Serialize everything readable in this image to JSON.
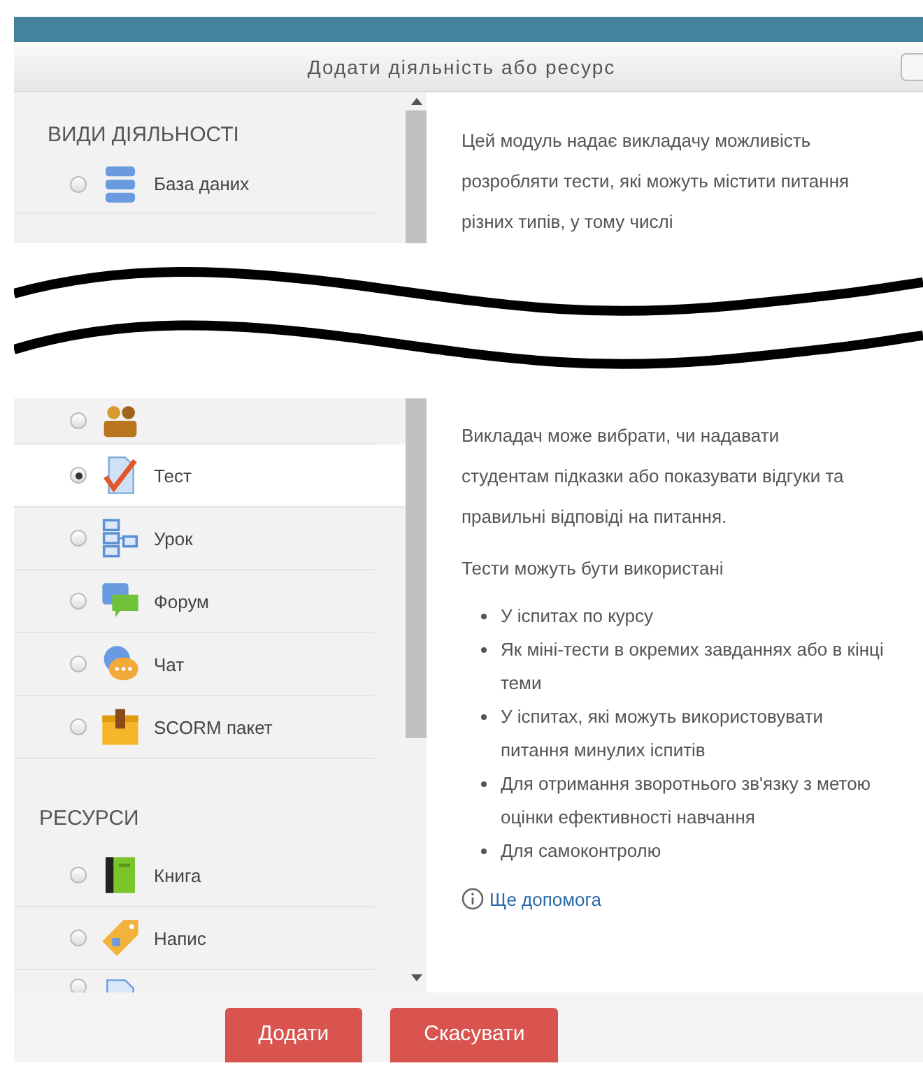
{
  "window": {
    "title": "Додати діяльність або ресурс"
  },
  "top": {
    "section": "ВИДИ ДІЯЛЬНОСТІ",
    "items": [
      {
        "label": "База даних",
        "kind": "database",
        "selected": false
      }
    ],
    "description": "Цей модуль надає викладачу можливість розробляти тести, які можуть містити питання різних типів, у тому числі"
  },
  "bottom": {
    "groups": [
      {
        "items": [
          {
            "kind": "workshop",
            "selected": false
          },
          {
            "label": "Тест",
            "kind": "quiz",
            "selected": true
          },
          {
            "label": "Урок",
            "kind": "lesson",
            "selected": false
          },
          {
            "label": "Форум",
            "kind": "forum",
            "selected": false
          },
          {
            "label": "Чат",
            "kind": "chat",
            "selected": false
          },
          {
            "label": "SCORM пакет",
            "kind": "package",
            "selected": false
          }
        ]
      },
      {
        "heading": "РЕСУРСИ",
        "items": [
          {
            "label": "Книга",
            "kind": "book",
            "selected": false
          },
          {
            "label": "Напис",
            "kind": "label",
            "selected": false
          },
          {
            "kind": "page",
            "selected": false
          }
        ]
      }
    ],
    "paragraphs": [
      "Викладач може вибрати, чи надавати студентам підказки або показувати відгуки та правильні відповіді на питання.",
      "Тести можуть бути використані"
    ],
    "uses": [
      "У іспитах по курсу",
      "Як міні-тести в окремих завданнях або в кінці теми",
      "У іспитах, які можуть використовувати питання минулих іспитів",
      "Для отримання зворотнього зв'язку з метою оцінки ефективності навчання",
      "Для самоконтролю"
    ],
    "help_link": "Ще допомога"
  },
  "buttons": [
    "Додати",
    "Скасувати"
  ]
}
